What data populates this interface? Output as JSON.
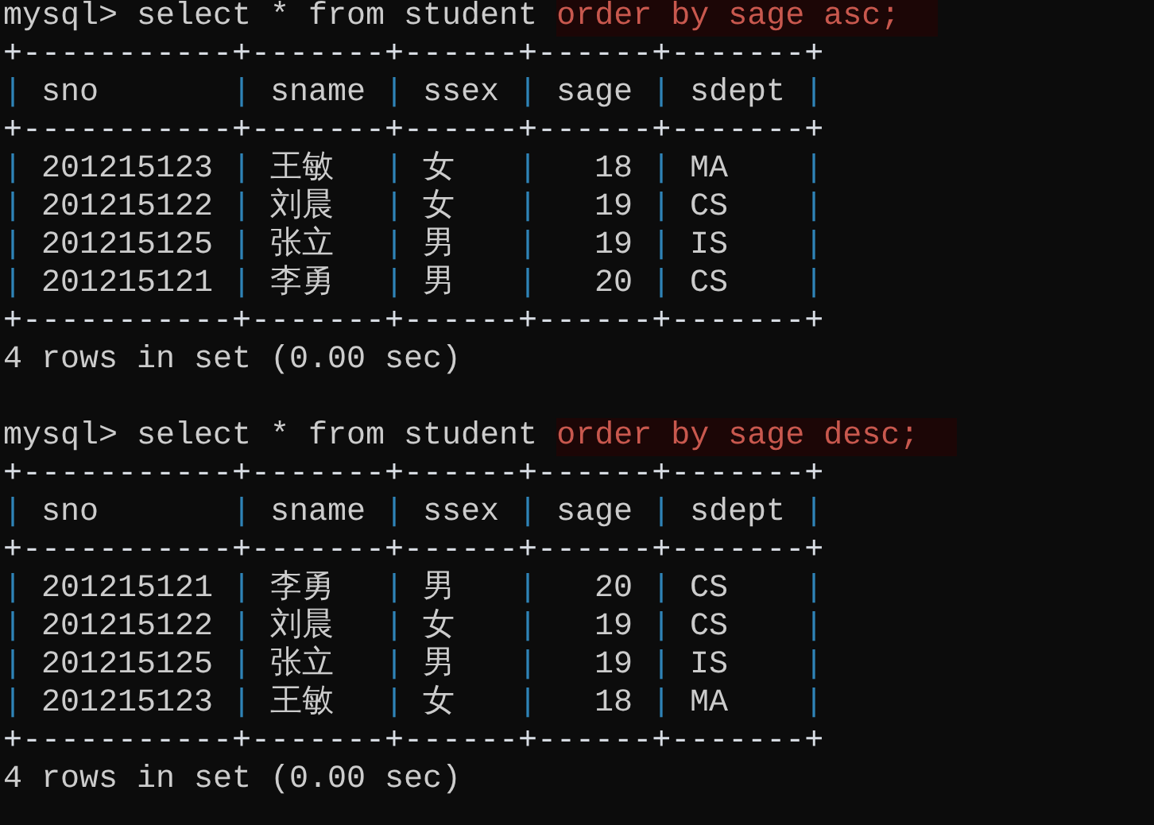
{
  "blocks": [
    {
      "prompt": "mysql>",
      "command": "select * from student",
      "clause": {
        "text": "order by sage asc;",
        "highlighted": true
      },
      "table": {
        "border": "+-----------+-------+------+------+-------+",
        "separator": "|",
        "columns": [
          {
            "label": "sno",
            "kind": "text"
          },
          {
            "label": "sname",
            "kind": "text"
          },
          {
            "label": "ssex",
            "kind": "text"
          },
          {
            "label": "sage",
            "kind": "number"
          },
          {
            "label": "sdept",
            "kind": "text"
          }
        ],
        "rows": [
          [
            "201215123",
            "王敏",
            "女",
            "18",
            "MA"
          ],
          [
            "201215122",
            "刘晨",
            "女",
            "19",
            "CS"
          ],
          [
            "201215125",
            "张立",
            "男",
            "19",
            "IS"
          ],
          [
            "201215121",
            "李勇",
            "男",
            "20",
            "CS"
          ]
        ]
      },
      "summary": "4 rows in set (0.00 sec)"
    },
    {
      "prompt": "mysql>",
      "command": "select * from student",
      "clause": {
        "text": "order by sage desc;",
        "highlighted": true
      },
      "table": {
        "border": "+-----------+-------+------+------+-------+",
        "separator": "|",
        "columns": [
          {
            "label": "sno",
            "kind": "text"
          },
          {
            "label": "sname",
            "kind": "text"
          },
          {
            "label": "ssex",
            "kind": "text"
          },
          {
            "label": "sage",
            "kind": "number"
          },
          {
            "label": "sdept",
            "kind": "text"
          }
        ],
        "rows": [
          [
            "201215121",
            "李勇",
            "男",
            "20",
            "CS"
          ],
          [
            "201215122",
            "刘晨",
            "女",
            "19",
            "CS"
          ],
          [
            "201215125",
            "张立",
            "男",
            "19",
            "IS"
          ],
          [
            "201215123",
            "王敏",
            "女",
            "18",
            "MA"
          ]
        ]
      },
      "summary": "4 rows in set (0.00 sec)"
    }
  ]
}
